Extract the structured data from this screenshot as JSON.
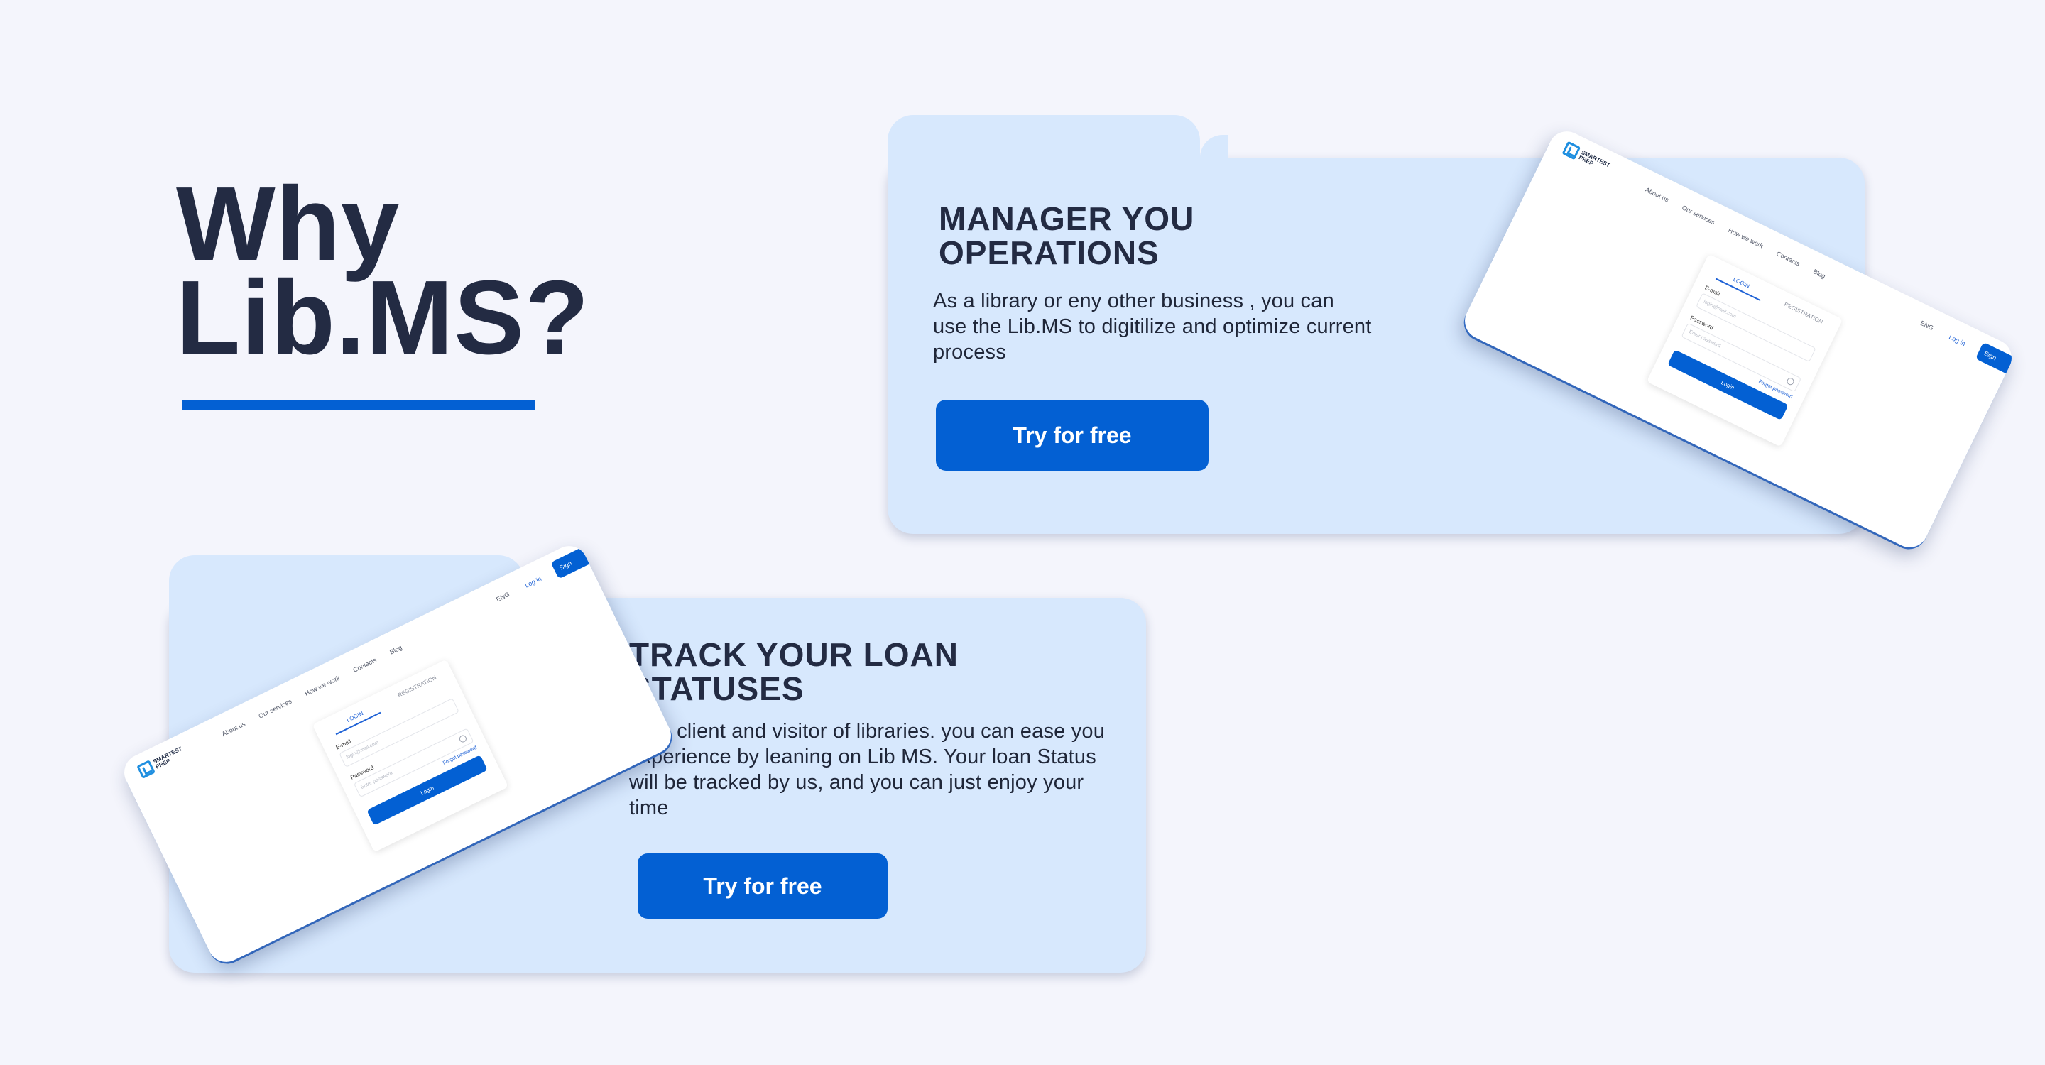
{
  "hero": {
    "line1": "Why",
    "line2": "Lib.MS?"
  },
  "cards": [
    {
      "title_line1": "MANAGER YOU",
      "title_line2": "OPERATIONS",
      "text": "As a library or eny other business , you can use the Lib.MS to digitilize and optimize current process",
      "button": "Try for free"
    },
    {
      "title_line1": "TRACK YOUR LOAN",
      "title_line2": "STATUSES",
      "text": "As a client and visitor of libraries. you can ease you experience by leaning on Lib MS. Your loan Status will be tracked by us, and you can just enjoy your time",
      "button": "Try for free"
    }
  ],
  "mockup": {
    "logo_text": "SMARTEST PREP",
    "nav": [
      "About us",
      "Our services",
      "How we work",
      "Contacts",
      "Blog"
    ],
    "lang": "ENG",
    "login_link": "Log in",
    "signup": "Sign",
    "tab_login": "LOGIN",
    "tab_registration": "REGISTRATION",
    "email_label": "E-mail",
    "email_placeholder": "login@mail.com",
    "password_label": "Password",
    "password_placeholder": "Enter password",
    "forgot": "Forgot password",
    "login_button": "Login"
  },
  "colors": {
    "background": "#f4f5fc",
    "card": "#d7e8fd",
    "accent": "#0360d3",
    "heading": "#232b43"
  }
}
